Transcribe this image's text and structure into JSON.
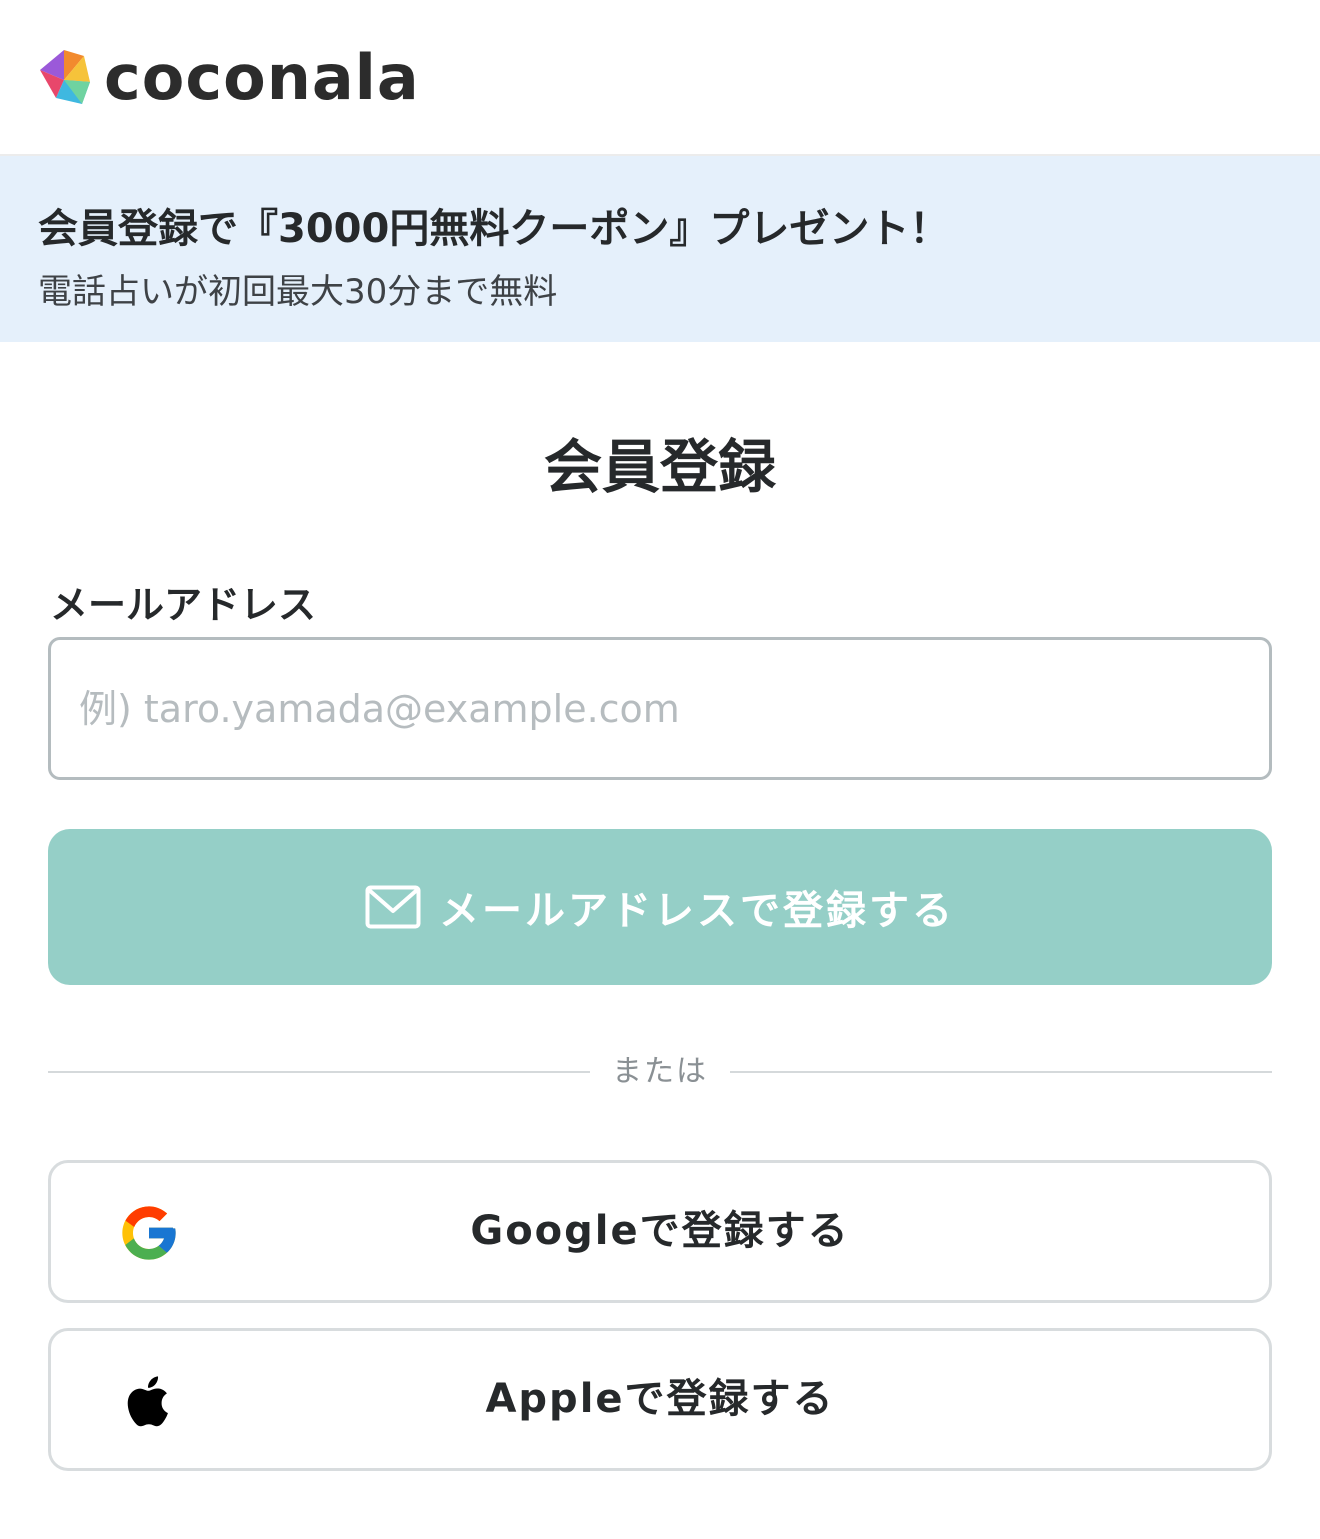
{
  "header": {
    "logo_text": "coconala",
    "logo_icon": "coconala-logo-icon"
  },
  "banner": {
    "title": "会員登録で『3000円無料クーポン』プレゼント！",
    "subtitle": "電話占いが初回最大30分まで無料"
  },
  "main": {
    "title": "会員登録",
    "email_label": "メールアドレス",
    "email_value": "",
    "email_placeholder": "例) taro.yamada@example.com",
    "email_button_label": "メールアドレスで登録する",
    "email_button_icon": "mail-icon",
    "divider_text": "または",
    "google_button_label": "Googleで登録する",
    "google_icon": "google-icon",
    "apple_button_label": "Appleで登録する",
    "apple_icon": "apple-icon"
  },
  "colors": {
    "banner_bg": "#e5f0fb",
    "primary_button_disabled": "#95cfc7",
    "text": "#26292b",
    "placeholder": "#b6bcbf"
  }
}
